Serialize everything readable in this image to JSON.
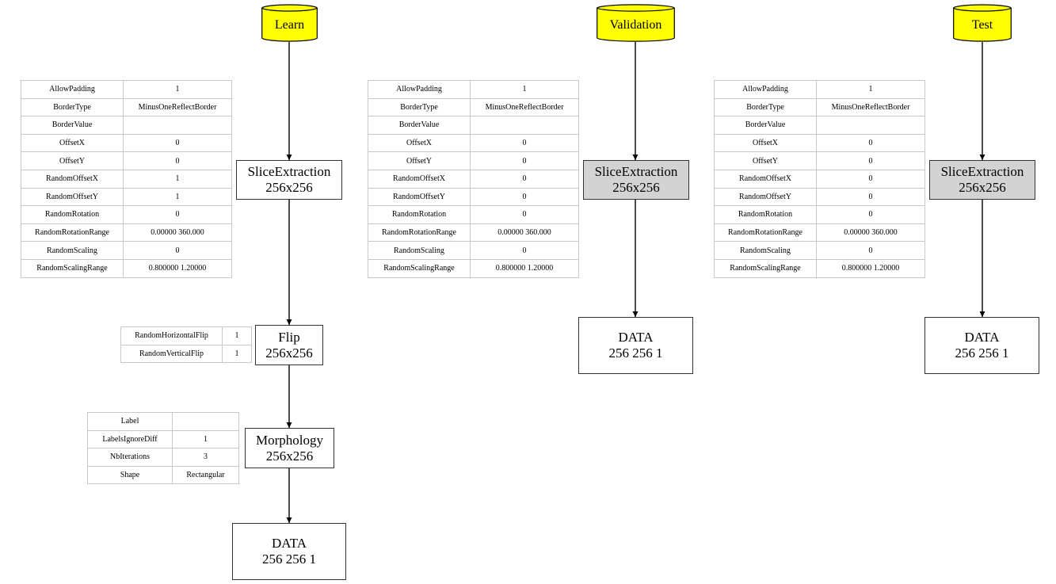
{
  "pipelines": [
    {
      "source": "Learn",
      "nodes": [
        {
          "title": "SliceExtraction",
          "size": "256x256",
          "style": "white"
        },
        {
          "title": "Flip",
          "size": "256x256",
          "style": "white"
        },
        {
          "title": "Morphology",
          "size": "256x256",
          "style": "white"
        },
        {
          "title": "DATA",
          "size": "256 256 1",
          "style": "white"
        }
      ],
      "tables": {
        "slice_extraction": [
          {
            "key": "AllowPadding",
            "value": "1"
          },
          {
            "key": "BorderType",
            "value": "MinusOneReflectBorder"
          },
          {
            "key": "BorderValue",
            "value": ""
          },
          {
            "key": "OffsetX",
            "value": "0"
          },
          {
            "key": "OffsetY",
            "value": "0"
          },
          {
            "key": "RandomOffsetX",
            "value": "1"
          },
          {
            "key": "RandomOffsetY",
            "value": "1"
          },
          {
            "key": "RandomRotation",
            "value": "0"
          },
          {
            "key": "RandomRotationRange",
            "value": "0.00000 360.000"
          },
          {
            "key": "RandomScaling",
            "value": "0"
          },
          {
            "key": "RandomScalingRange",
            "value": "0.800000 1.20000"
          }
        ],
        "flip": [
          {
            "key": "RandomHorizontalFlip",
            "value": "1"
          },
          {
            "key": "RandomVerticalFlip",
            "value": "1"
          }
        ],
        "morphology": [
          {
            "key": "Label",
            "value": ""
          },
          {
            "key": "LabelsIgnoreDiff",
            "value": "1"
          },
          {
            "key": "NbIterations",
            "value": "3"
          },
          {
            "key": "Shape",
            "value": "Rectangular"
          }
        ]
      }
    },
    {
      "source": "Validation",
      "nodes": [
        {
          "title": "SliceExtraction",
          "size": "256x256",
          "style": "gray"
        },
        {
          "title": "DATA",
          "size": "256 256 1",
          "style": "white"
        }
      ],
      "tables": {
        "slice_extraction": [
          {
            "key": "AllowPadding",
            "value": "1"
          },
          {
            "key": "BorderType",
            "value": "MinusOneReflectBorder"
          },
          {
            "key": "BorderValue",
            "value": ""
          },
          {
            "key": "OffsetX",
            "value": "0"
          },
          {
            "key": "OffsetY",
            "value": "0"
          },
          {
            "key": "RandomOffsetX",
            "value": "0"
          },
          {
            "key": "RandomOffsetY",
            "value": "0"
          },
          {
            "key": "RandomRotation",
            "value": "0"
          },
          {
            "key": "RandomRotationRange",
            "value": "0.00000 360.000"
          },
          {
            "key": "RandomScaling",
            "value": "0"
          },
          {
            "key": "RandomScalingRange",
            "value": "0.800000 1.20000"
          }
        ]
      }
    },
    {
      "source": "Test",
      "nodes": [
        {
          "title": "SliceExtraction",
          "size": "256x256",
          "style": "gray"
        },
        {
          "title": "DATA",
          "size": "256 256 1",
          "style": "white"
        }
      ],
      "tables": {
        "slice_extraction": [
          {
            "key": "AllowPadding",
            "value": "1"
          },
          {
            "key": "BorderType",
            "value": "MinusOneReflectBorder"
          },
          {
            "key": "BorderValue",
            "value": ""
          },
          {
            "key": "OffsetX",
            "value": "0"
          },
          {
            "key": "OffsetY",
            "value": "0"
          },
          {
            "key": "RandomOffsetX",
            "value": "0"
          },
          {
            "key": "RandomOffsetY",
            "value": "0"
          },
          {
            "key": "RandomRotation",
            "value": "0"
          },
          {
            "key": "RandomRotationRange",
            "value": "0.00000 360.000"
          },
          {
            "key": "RandomScaling",
            "value": "0"
          },
          {
            "key": "RandomScalingRange",
            "value": "0.800000 1.20000"
          }
        ]
      }
    }
  ],
  "colors": {
    "database_fill": "#ffff00",
    "inactive_node_fill": "#d3d3d3",
    "active_node_fill": "#ffffff",
    "table_border": "#c8c8c8"
  }
}
